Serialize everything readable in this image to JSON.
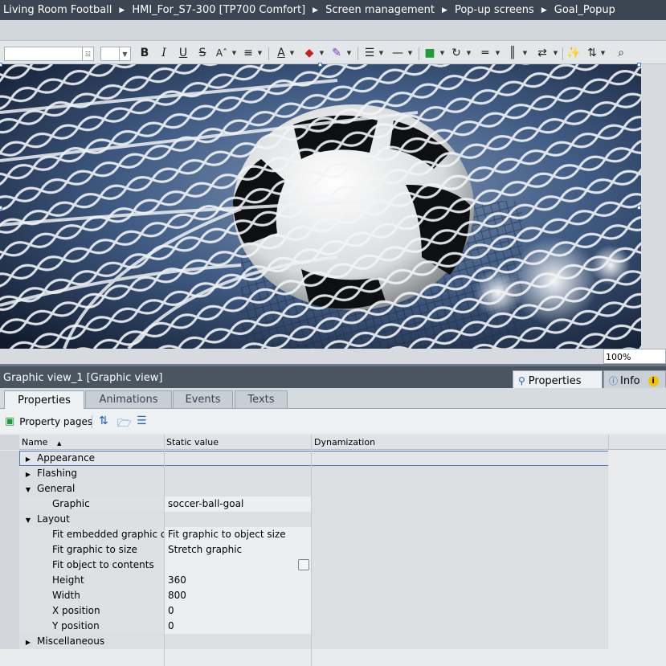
{
  "breadcrumb": [
    "Living Room Football",
    "HMI_For_S7-300 [TP700 Comfort]",
    "Screen management",
    "Pop-up screens",
    "Goal_Popup"
  ],
  "toolbar": {
    "bold": "B",
    "italic": "I",
    "underline": "U",
    "strike": "S",
    "fontgrow": "Aˆ",
    "align": "≡",
    "fontcolor": "A",
    "fill": "◆",
    "pen": "✎",
    "line": "☰",
    "linedash": "—",
    "arrange": "■",
    "rotate": "↻",
    "distrib1": "═",
    "distrib2": "║",
    "distrib3": "⇄",
    "clear": "✨",
    "sort": "⇅",
    "zoomsel": "⌕"
  },
  "canvas": {
    "zoom": "100%",
    "graphic_icon": "soccer-ball-goal"
  },
  "inspector": {
    "title": "Graphic view_1 [Graphic view]",
    "tab_properties": "Properties",
    "tab_info": "Info",
    "info_badge": "i"
  },
  "subtabs": [
    "Properties",
    "Animations",
    "Events",
    "Texts"
  ],
  "ptoolbar": {
    "property_pages": "Property pages"
  },
  "grid": {
    "headers": {
      "name": "Name",
      "static": "Static value",
      "dyn": "Dynamization"
    },
    "sort_indicator": "▲",
    "rows": [
      {
        "kind": "group",
        "expanded": false,
        "name": "Appearance",
        "value": "",
        "selected": true
      },
      {
        "kind": "group",
        "expanded": false,
        "name": "Flashing",
        "value": ""
      },
      {
        "kind": "group",
        "expanded": true,
        "name": "General",
        "value": ""
      },
      {
        "kind": "item",
        "name": "Graphic",
        "value": "soccer-ball-goal"
      },
      {
        "kind": "group",
        "expanded": true,
        "name": "Layout",
        "value": ""
      },
      {
        "kind": "item",
        "name": "Fit embedded graphic o...",
        "value": "Fit graphic to object size"
      },
      {
        "kind": "item",
        "name": "Fit graphic to size",
        "value": "Stretch graphic"
      },
      {
        "kind": "item",
        "name": "Fit object to contents",
        "value": "",
        "checkbox": true,
        "checked": false
      },
      {
        "kind": "item",
        "name": "Height",
        "value": "360"
      },
      {
        "kind": "item",
        "name": "Width",
        "value": "800"
      },
      {
        "kind": "item",
        "name": "X position",
        "value": "0"
      },
      {
        "kind": "item",
        "name": "Y position",
        "value": "0"
      },
      {
        "kind": "group",
        "expanded": false,
        "name": "Miscellaneous",
        "value": ""
      }
    ]
  },
  "colors": {
    "breadcrumb_bg": "#3c4652",
    "accent_blue": "#1d5fbf",
    "selection_border": "#4b78b8",
    "info_yellow": "#f2c400"
  }
}
